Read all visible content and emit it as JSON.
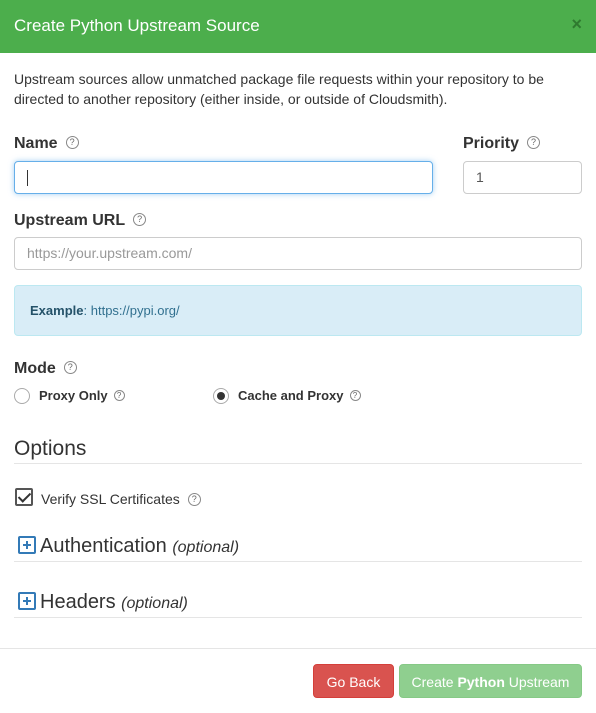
{
  "modal": {
    "title": "Create Python Upstream Source",
    "close_glyph": "×"
  },
  "intro_text": "Upstream sources allow unmatched package file requests within your repository to be directed to another repository (either inside, or outside of Cloudsmith).",
  "help_glyph": "?",
  "fields": {
    "name_label": "Name",
    "name_value": "",
    "priority_label": "Priority",
    "priority_value": "1",
    "url_label": "Upstream URL",
    "url_placeholder": "https://your.upstream.com/"
  },
  "example": {
    "prefix": "Example",
    "colon": ":",
    "url": "https://pypi.org/"
  },
  "mode": {
    "label": "Mode",
    "options": [
      {
        "label": "Proxy Only",
        "selected": false
      },
      {
        "label": "Cache and Proxy",
        "selected": true
      }
    ]
  },
  "options": {
    "heading": "Options",
    "verify_ssl_label": "Verify SSL Certificates",
    "verify_ssl_checked": true
  },
  "sections": {
    "authentication": {
      "title": "Authentication",
      "suffix": "(optional)"
    },
    "headers": {
      "title": "Headers",
      "suffix": "(optional)"
    }
  },
  "footer": {
    "go_back_label": "Go Back",
    "create_prefix": "Create",
    "create_bold": "Python",
    "create_suffix": "Upstream"
  },
  "colors": {
    "header_green": "#4cae4c",
    "danger": "#d9534f",
    "success_disabled": "#8fcf8f",
    "info_bg": "#d9edf7",
    "link_blue": "#337ab7"
  }
}
